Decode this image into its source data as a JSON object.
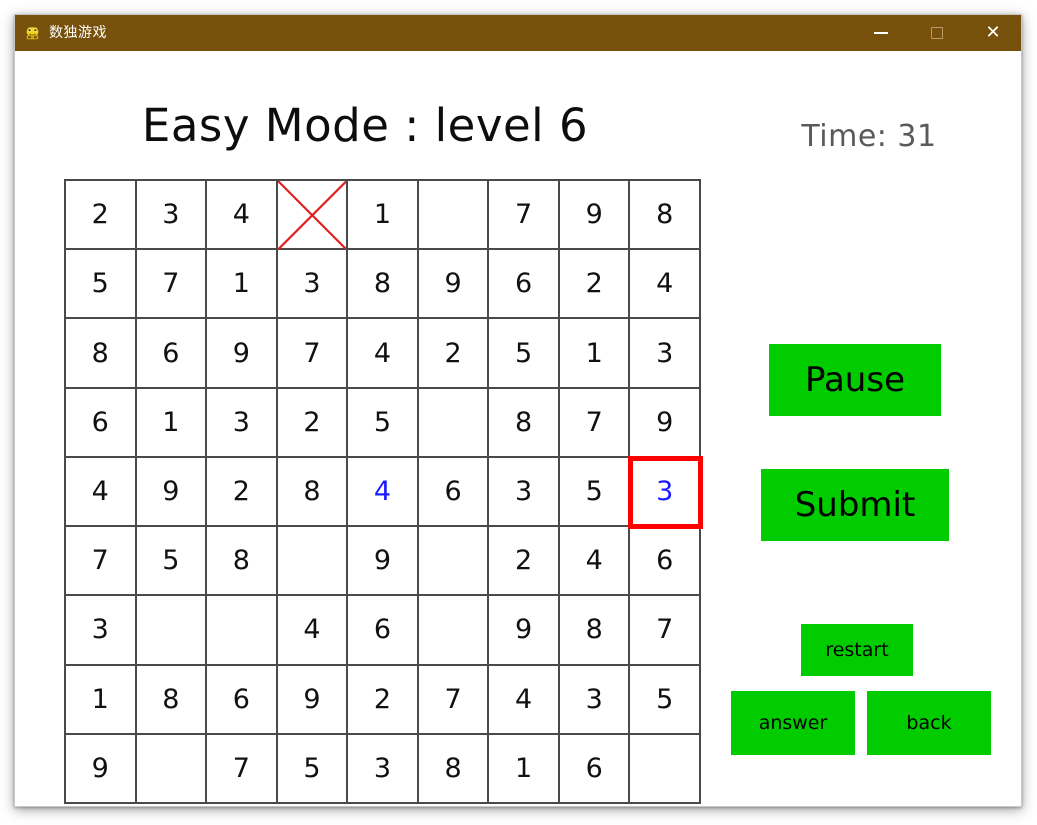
{
  "window": {
    "title": "数独游戏",
    "icon": "app-frog-icon",
    "controls": {
      "minimize": "—",
      "maximize": "□",
      "close": "✕"
    },
    "titlebar_color": "#77500c"
  },
  "header": {
    "mode_title": "Easy Mode : level 6",
    "timer_label": "Time: 31"
  },
  "colors": {
    "button_green": "#00cc00",
    "given_number": "#111111",
    "user_number": "#1a1aff",
    "selection_border": "#ff0000",
    "cross_mark": "#e02020",
    "grid_line": "#4a4a4a"
  },
  "board": {
    "rows": 9,
    "cols": 9,
    "selected_cell": {
      "row": 4,
      "col": 8
    },
    "crossed_cell": {
      "row": 0,
      "col": 3
    },
    "cells": [
      [
        {
          "v": "2",
          "t": "given"
        },
        {
          "v": "3",
          "t": "given"
        },
        {
          "v": "4",
          "t": "given"
        },
        {
          "v": "",
          "t": "cross"
        },
        {
          "v": "1",
          "t": "given"
        },
        {
          "v": "",
          "t": "empty"
        },
        {
          "v": "7",
          "t": "given"
        },
        {
          "v": "9",
          "t": "given"
        },
        {
          "v": "8",
          "t": "given"
        }
      ],
      [
        {
          "v": "5",
          "t": "given"
        },
        {
          "v": "7",
          "t": "given"
        },
        {
          "v": "1",
          "t": "given"
        },
        {
          "v": "3",
          "t": "given"
        },
        {
          "v": "8",
          "t": "given"
        },
        {
          "v": "9",
          "t": "given"
        },
        {
          "v": "6",
          "t": "given"
        },
        {
          "v": "2",
          "t": "given"
        },
        {
          "v": "4",
          "t": "given"
        }
      ],
      [
        {
          "v": "8",
          "t": "given"
        },
        {
          "v": "6",
          "t": "given"
        },
        {
          "v": "9",
          "t": "given"
        },
        {
          "v": "7",
          "t": "given"
        },
        {
          "v": "4",
          "t": "given"
        },
        {
          "v": "2",
          "t": "given"
        },
        {
          "v": "5",
          "t": "given"
        },
        {
          "v": "1",
          "t": "given"
        },
        {
          "v": "3",
          "t": "given"
        }
      ],
      [
        {
          "v": "6",
          "t": "given"
        },
        {
          "v": "1",
          "t": "given"
        },
        {
          "v": "3",
          "t": "given"
        },
        {
          "v": "2",
          "t": "given"
        },
        {
          "v": "5",
          "t": "given"
        },
        {
          "v": "",
          "t": "empty"
        },
        {
          "v": "8",
          "t": "given"
        },
        {
          "v": "7",
          "t": "given"
        },
        {
          "v": "9",
          "t": "given"
        }
      ],
      [
        {
          "v": "4",
          "t": "given"
        },
        {
          "v": "9",
          "t": "given"
        },
        {
          "v": "2",
          "t": "given"
        },
        {
          "v": "8",
          "t": "given"
        },
        {
          "v": "4",
          "t": "user"
        },
        {
          "v": "6",
          "t": "given"
        },
        {
          "v": "3",
          "t": "given"
        },
        {
          "v": "5",
          "t": "given"
        },
        {
          "v": "3",
          "t": "user-selected"
        }
      ],
      [
        {
          "v": "7",
          "t": "given"
        },
        {
          "v": "5",
          "t": "given"
        },
        {
          "v": "8",
          "t": "given"
        },
        {
          "v": "",
          "t": "empty"
        },
        {
          "v": "9",
          "t": "given"
        },
        {
          "v": "",
          "t": "empty"
        },
        {
          "v": "2",
          "t": "given"
        },
        {
          "v": "4",
          "t": "given"
        },
        {
          "v": "6",
          "t": "given"
        }
      ],
      [
        {
          "v": "3",
          "t": "given"
        },
        {
          "v": "",
          "t": "empty"
        },
        {
          "v": "",
          "t": "empty"
        },
        {
          "v": "4",
          "t": "given"
        },
        {
          "v": "6",
          "t": "given"
        },
        {
          "v": "",
          "t": "empty"
        },
        {
          "v": "9",
          "t": "given"
        },
        {
          "v": "8",
          "t": "given"
        },
        {
          "v": "7",
          "t": "given"
        }
      ],
      [
        {
          "v": "1",
          "t": "given"
        },
        {
          "v": "8",
          "t": "given"
        },
        {
          "v": "6",
          "t": "given"
        },
        {
          "v": "9",
          "t": "given"
        },
        {
          "v": "2",
          "t": "given"
        },
        {
          "v": "7",
          "t": "given"
        },
        {
          "v": "4",
          "t": "given"
        },
        {
          "v": "3",
          "t": "given"
        },
        {
          "v": "5",
          "t": "given"
        }
      ],
      [
        {
          "v": "9",
          "t": "given"
        },
        {
          "v": "",
          "t": "empty"
        },
        {
          "v": "7",
          "t": "given"
        },
        {
          "v": "5",
          "t": "given"
        },
        {
          "v": "3",
          "t": "given"
        },
        {
          "v": "8",
          "t": "given"
        },
        {
          "v": "1",
          "t": "given"
        },
        {
          "v": "6",
          "t": "given"
        },
        {
          "v": "",
          "t": "empty"
        }
      ]
    ]
  },
  "buttons": {
    "pause": "Pause",
    "submit": "Submit",
    "restart": "restart",
    "answer": "answer",
    "back": "back"
  }
}
